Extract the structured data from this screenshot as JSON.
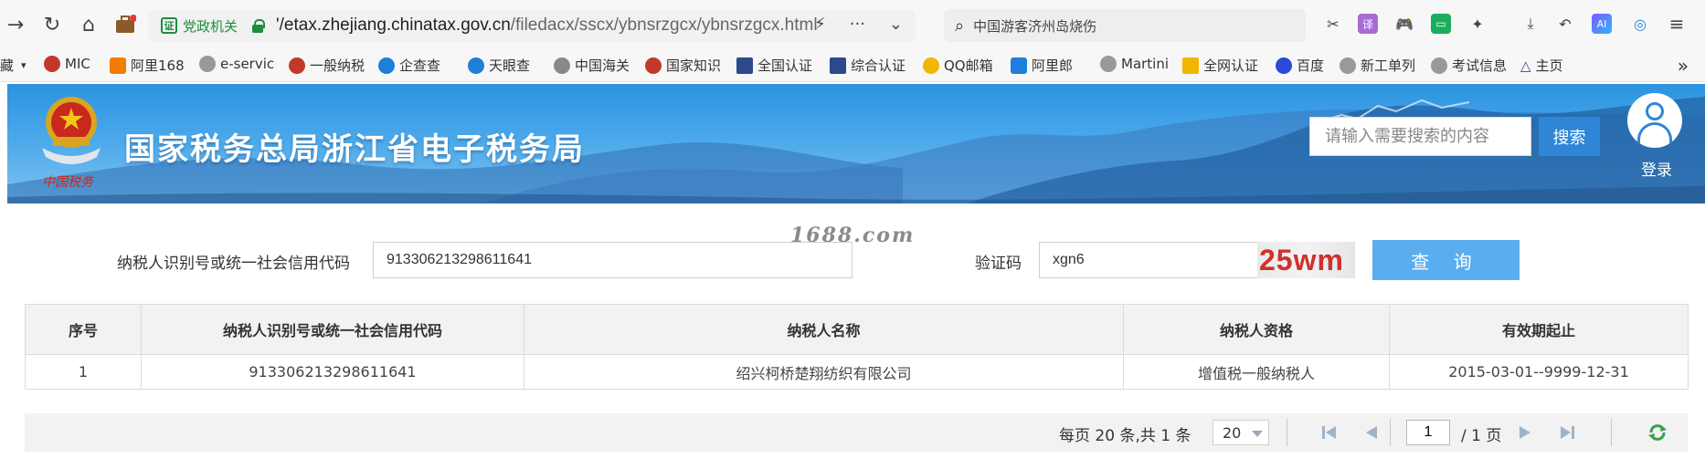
{
  "browser": {
    "address_badge": "党政机关",
    "url_domain": "'/etax.zhejiang.chinatax.gov.cn",
    "url_path": "/filedacx/sscx/ybnsrzgcx/ybnsrzgcx.html",
    "search_text": "中国游客济州岛烧伤"
  },
  "bookmarks": [
    {
      "label": "藏",
      "color": "#666666"
    },
    {
      "label": "MIC",
      "color": "#c0392b"
    },
    {
      "label": "阿里168",
      "color": "#f07c00"
    },
    {
      "label": "e-servic",
      "color": "#888888"
    },
    {
      "label": "一般纳税",
      "color": "#c0392b"
    },
    {
      "label": "企查查",
      "color": "#1e7fd8"
    },
    {
      "label": "天眼查",
      "color": "#1e7fd8"
    },
    {
      "label": "中国海关",
      "color": "#888888"
    },
    {
      "label": "国家知识",
      "color": "#c0392b"
    },
    {
      "label": "全国认证",
      "color": "#2b4a8a"
    },
    {
      "label": "综合认证",
      "color": "#2b4a8a"
    },
    {
      "label": "QQ邮箱",
      "color": "#f2b600"
    },
    {
      "label": "阿里郎",
      "color": "#1e7fd8"
    },
    {
      "label": "Martini",
      "color": "#888888"
    },
    {
      "label": "全网认证",
      "color": "#f2b600"
    },
    {
      "label": "百度",
      "color": "#2b4ad8"
    },
    {
      "label": "新工单列",
      "color": "#888888"
    },
    {
      "label": "考试信息",
      "color": "#888888"
    },
    {
      "label": "主页",
      "color": "#2b4a8a"
    }
  ],
  "site": {
    "title": "国家税务总局浙江省电子税务局",
    "search_placeholder": "请输入需要搜索的内容",
    "search_button": "搜索",
    "login": "登录"
  },
  "form": {
    "watermark": "1688.com",
    "taxpayer_label": "纳税人识别号或统一社会信用代码",
    "taxpayer_value": "913306213298611641",
    "captcha_label": "验证码",
    "captcha_value": "xgn6",
    "captcha_image_text": "25wm",
    "query_button": "查 询"
  },
  "table": {
    "headers": [
      "序号",
      "纳税人识别号或统一社会信用代码",
      "纳税人名称",
      "纳税人资格",
      "有效期起止"
    ],
    "rows": [
      [
        "1",
        "913306213298611641",
        "绍兴柯桥楚翔纺织有限公司",
        "增值税一般纳税人",
        "2015-03-01--9999-12-31"
      ]
    ]
  },
  "pager": {
    "summary": "每页 20 条,共 1 条",
    "page_size": "20",
    "current_page": "1",
    "total_pages": "/ 1 页"
  }
}
